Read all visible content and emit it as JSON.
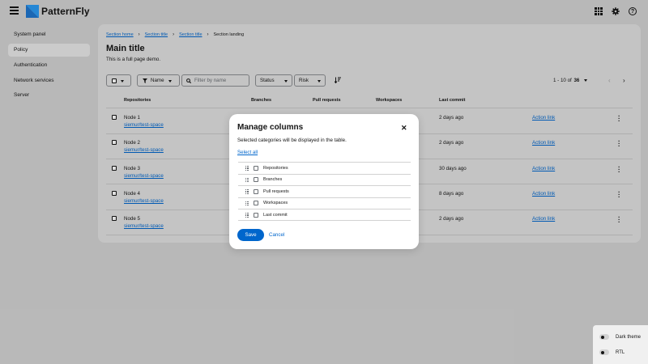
{
  "masthead": {
    "brand": "PatternFly",
    "icons": [
      "menu-icon",
      "app-launcher-icon",
      "gear-icon",
      "help-icon"
    ],
    "help_glyph": "?"
  },
  "sidebar": {
    "items": [
      {
        "label": "System panel",
        "active": false
      },
      {
        "label": "Policy",
        "active": true
      },
      {
        "label": "Authentication",
        "active": false
      },
      {
        "label": "Network services",
        "active": false
      },
      {
        "label": "Server",
        "active": false
      }
    ]
  },
  "breadcrumb": {
    "items": [
      "Section home",
      "Section title",
      "Section title"
    ],
    "current": "Section landing"
  },
  "page": {
    "title": "Main title",
    "description": "This is a full page demo."
  },
  "toolbar": {
    "filter_attribute": "Name",
    "search_placeholder": "Filter by name",
    "status_label": "Status",
    "risk_label": "Risk",
    "pagination": {
      "range": "1 - 10",
      "of": "of",
      "total": "36"
    }
  },
  "table": {
    "headers": [
      "Repositories",
      "Branches",
      "Pull requests",
      "Workspaces",
      "Last commit"
    ],
    "rows": [
      {
        "name": "Node 1",
        "link": "siemur/test-space",
        "last_commit": "2 days ago",
        "action": "Action link"
      },
      {
        "name": "Node 2",
        "link": "siemur/test-space",
        "last_commit": "2 days ago",
        "action": "Action link"
      },
      {
        "name": "Node 3",
        "link": "siemur/test-space",
        "last_commit": "30 days ago",
        "action": "Action link"
      },
      {
        "name": "Node 4",
        "link": "siemur/test-space",
        "last_commit": "8 days ago",
        "action": "Action link"
      },
      {
        "name": "Node 5",
        "link": "siemur/test-space",
        "last_commit": "2 days ago",
        "action": "Action link"
      }
    ]
  },
  "modal": {
    "title": "Manage columns",
    "description": "Selected categories will be displayed in the table.",
    "select_all": "Select all",
    "columns": [
      "Repositories",
      "Branches",
      "Pull requests",
      "Workspaces",
      "Last commit"
    ],
    "save": "Save",
    "cancel": "Cancel"
  },
  "theme_panel": {
    "dark_theme": "Dark theme",
    "rtl": "RTL"
  },
  "colors": {
    "link": "#0066cc",
    "primary_button": "#0066cc",
    "page_background": "#d2d2d2"
  }
}
